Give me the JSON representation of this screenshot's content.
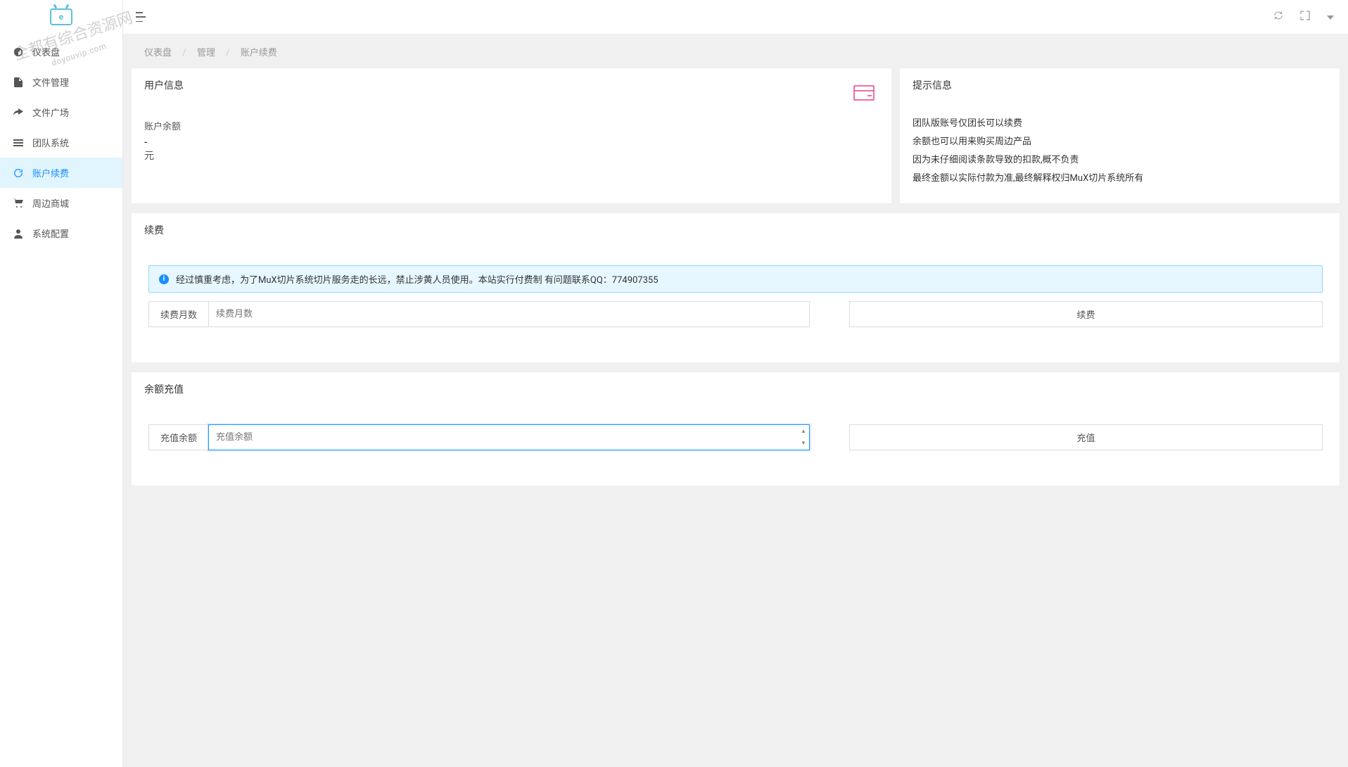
{
  "watermark": {
    "line1": "全都有综合资源网",
    "line2": "doyouvip.com"
  },
  "sidebar": {
    "items": [
      {
        "icon": "dashboard",
        "label": "仪表盘"
      },
      {
        "icon": "file",
        "label": "文件管理"
      },
      {
        "icon": "share",
        "label": "文件广场"
      },
      {
        "icon": "menu",
        "label": "团队系统"
      },
      {
        "icon": "refresh",
        "label": "账户续费"
      },
      {
        "icon": "cart",
        "label": "周边商城"
      },
      {
        "icon": "user",
        "label": "系统配置"
      }
    ]
  },
  "breadcrumb": {
    "items": [
      "仪表盘",
      "管理",
      "账户续费"
    ]
  },
  "user_info": {
    "title": "用户信息",
    "balance_label": "账户余额",
    "balance_value": "-",
    "balance_unit": "元"
  },
  "tips": {
    "title": "提示信息",
    "items": [
      "团队版账号仅团长可以续费",
      "余额也可以用来购买周边产品",
      "因为未仔细阅读条款导致的扣款,概不负责",
      "最终金额以实际付款为准,最终解释权归MuX切片系统所有"
    ]
  },
  "renew": {
    "title": "续费",
    "alert": "经过慎重考虑，为了MuX切片系统切片服务走的长远，禁止涉黄人员使用。本站实行付费制 有问题联系QQ：774907355",
    "months_label": "续费月数",
    "months_placeholder": "续费月数",
    "button": "续费"
  },
  "recharge": {
    "title": "余额充值",
    "amount_label": "充值余额",
    "amount_placeholder": "充值余额",
    "button": "充值"
  }
}
